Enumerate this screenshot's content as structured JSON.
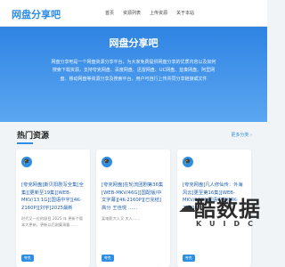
{
  "header": {
    "logo": "网盘分享吧",
    "nav": [
      "首页",
      "资源列表",
      "上传资源",
      "关于本站"
    ]
  },
  "hero": {
    "title": "网盘分享吧",
    "description": "网盘分享吧是一个网盘资源分享平台，为大家免费提供网盘分享的优质内容以及如何搜索下载资源，支持夸克网盘、百度网盘、迅雷网盘、UC网盘、蓝奏网盘、阿里网盘、移动网盘等资源分享及搜索平台，用户可自行上传共同分享链接或文件"
  },
  "section": {
    "title": "热门资源",
    "more": "更多分类 ›"
  },
  "cards": [
    {
      "icon": "graduation-cap-icon",
      "title": "[夸克网盘]斯贝阳剧写全集[全集][更新至19集][WEB-MKV/13.1G][国语中字][4K-2160P][刘宇]2025最新",
      "desc": "时代又一位的剧目 2025 年 更新个版本大更新，更新以后剧集观看……",
      "tag": "夸克"
    },
    {
      "icon": "graduation-cap-icon",
      "title": "[夸克网盘]在轮流团剧第36集[WEB-MKV/46G][国配版/中文字幕][4K-2160P][已完结] 高分 王佳悦 ……",
      "desc": "某电影大人又 大人……",
      "tag": "夸克"
    },
    {
      "icon": "graduation-cap-icon",
      "title": "[夸克网盘]凡人修仙传：外海风云[更至第16集][WEB-MKV/18G][国语中字][4K-2160P]",
      "desc": "",
      "tag": "夸克"
    }
  ],
  "watermark": {
    "cn": "酷数据",
    "en": "KUIDC"
  }
}
